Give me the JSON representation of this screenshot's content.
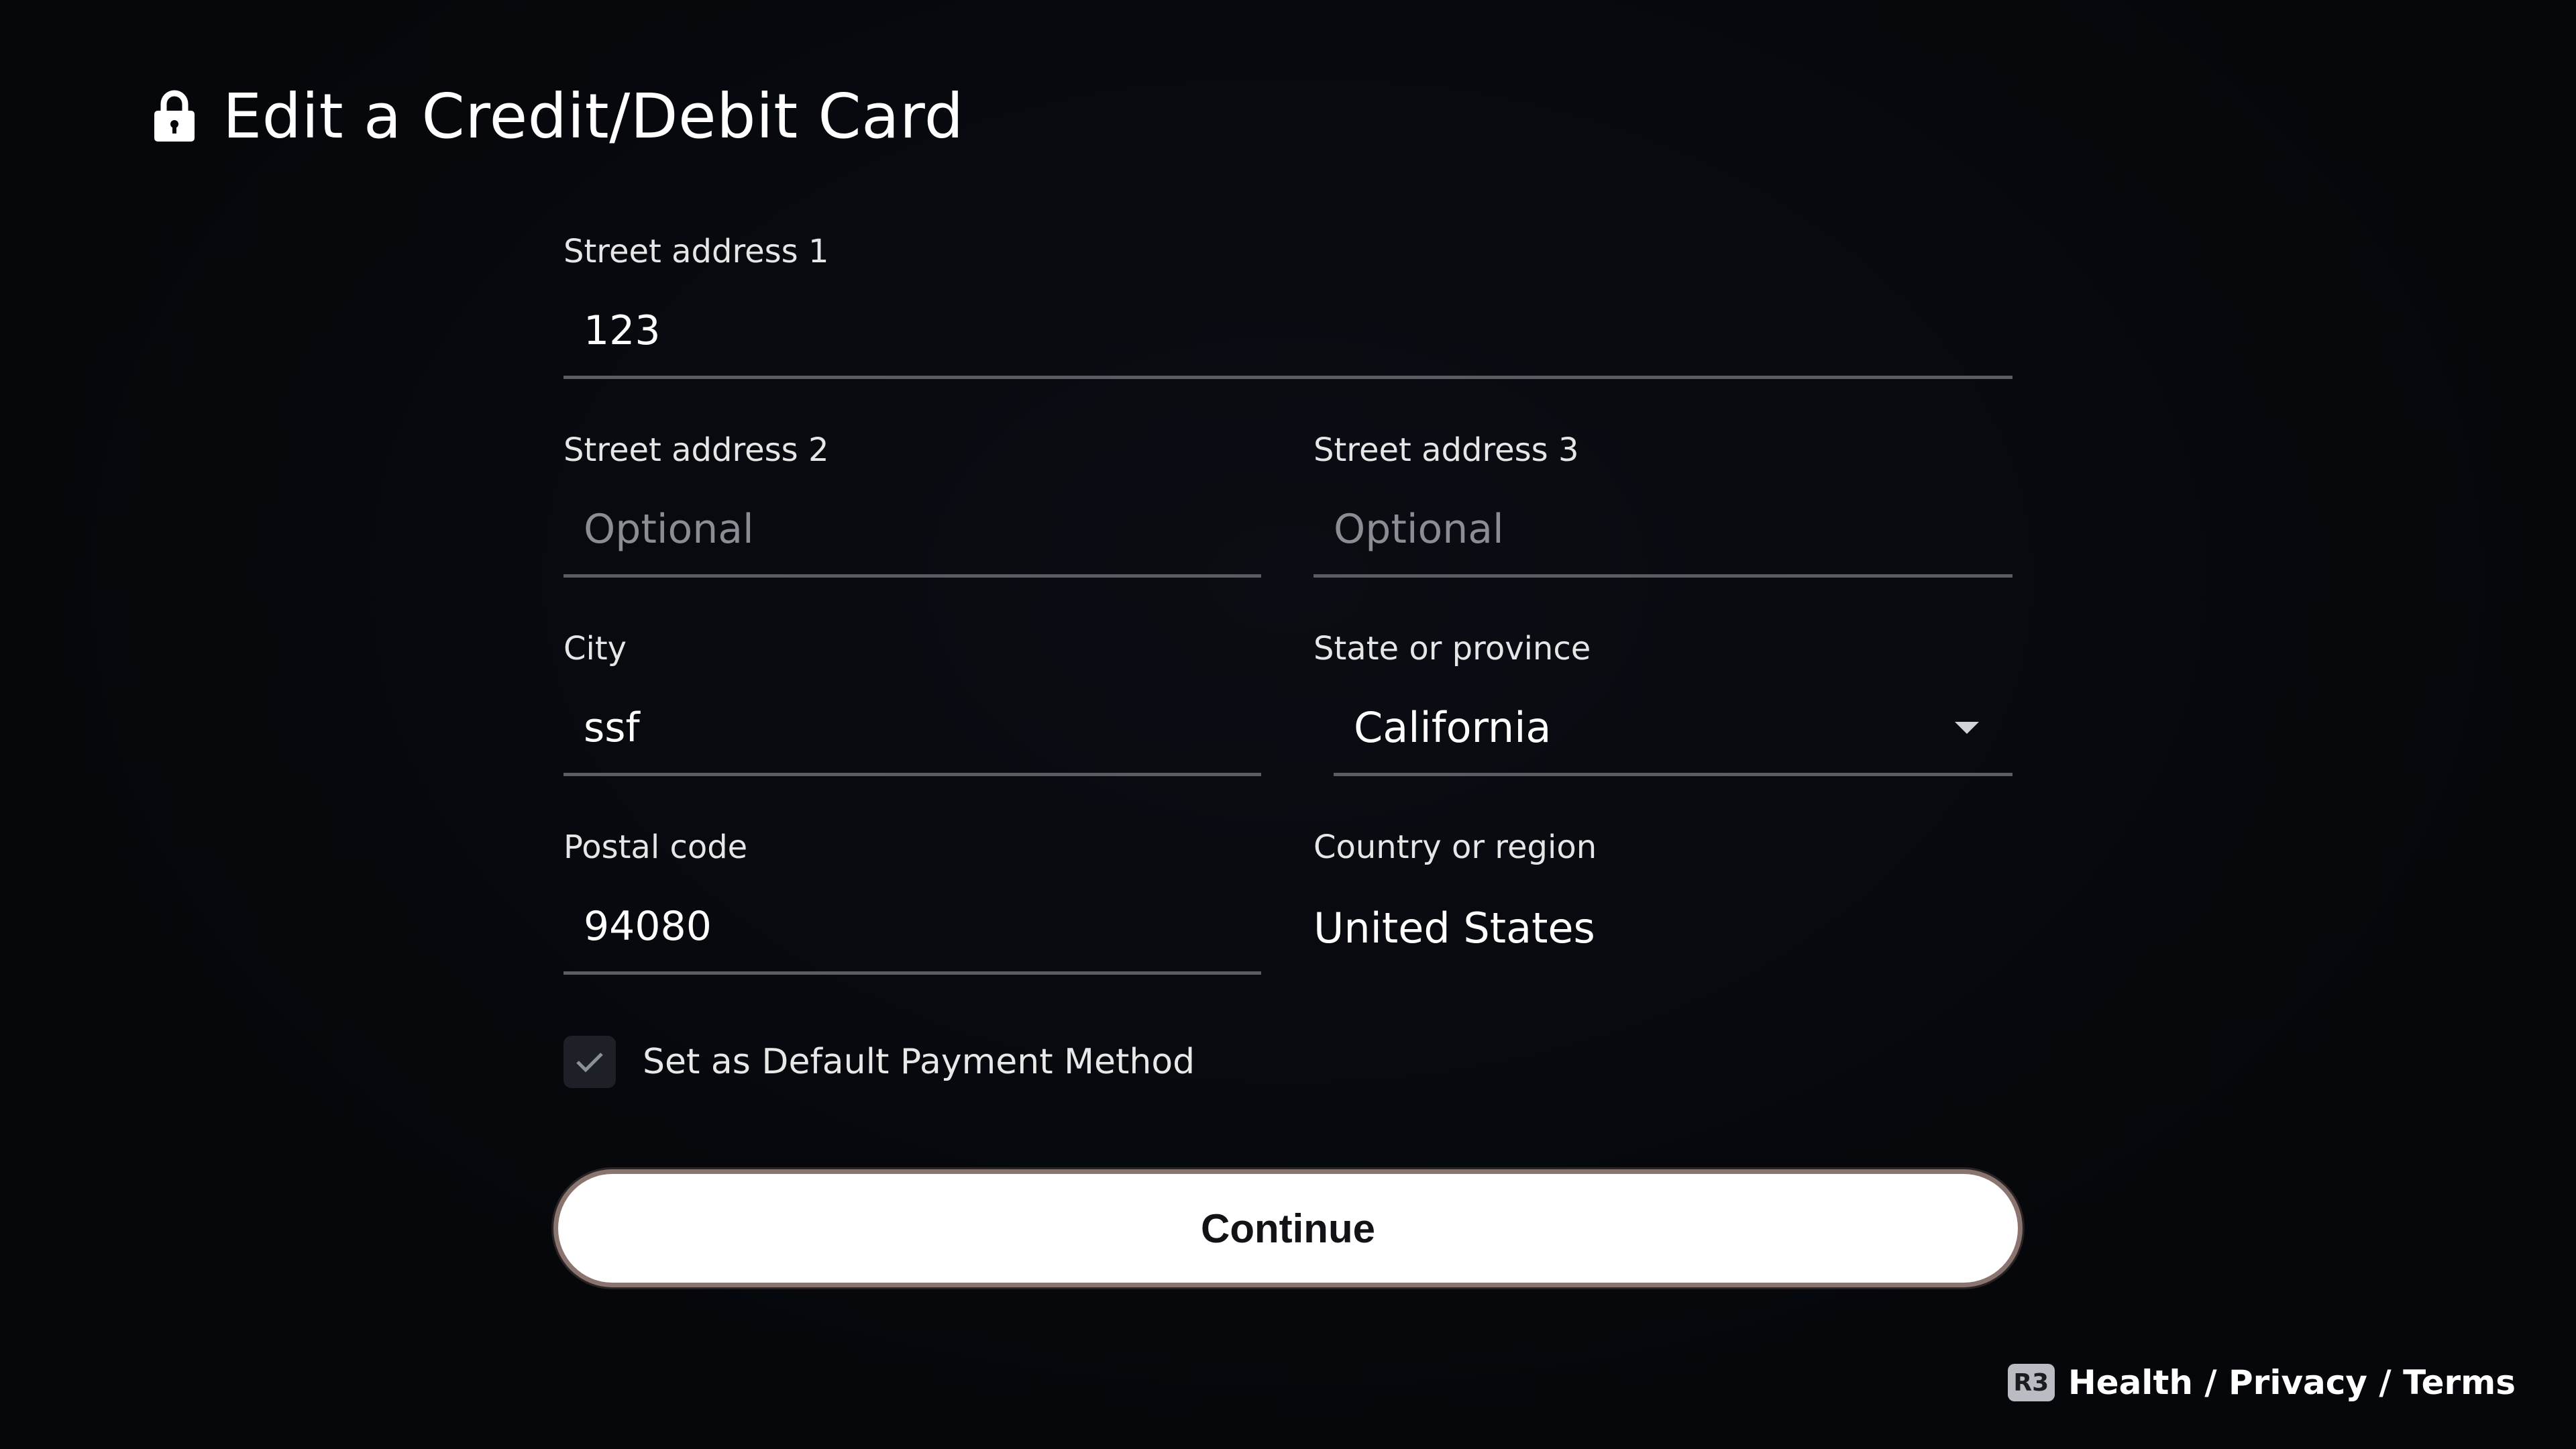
{
  "header": {
    "title": "Edit a Credit/Debit Card"
  },
  "form": {
    "street1": {
      "label": "Street address 1",
      "value": "123"
    },
    "street2": {
      "label": "Street address 2",
      "placeholder": "Optional"
    },
    "street3": {
      "label": "Street address 3",
      "placeholder": "Optional"
    },
    "city": {
      "label": "City",
      "value": "ssf"
    },
    "state": {
      "label": "State or province",
      "value": "California"
    },
    "postal": {
      "label": "Postal code",
      "value": "94080"
    },
    "country": {
      "label": "Country or region",
      "value": "United States"
    },
    "default_payment": {
      "label": "Set as Default Payment Method",
      "checked": true
    }
  },
  "actions": {
    "continue_label": "Continue"
  },
  "footer": {
    "badge": "R3",
    "links_text": "Health / Privacy / Terms"
  },
  "colors": {
    "background": "#05070b",
    "accent_button": "#ffffff"
  }
}
